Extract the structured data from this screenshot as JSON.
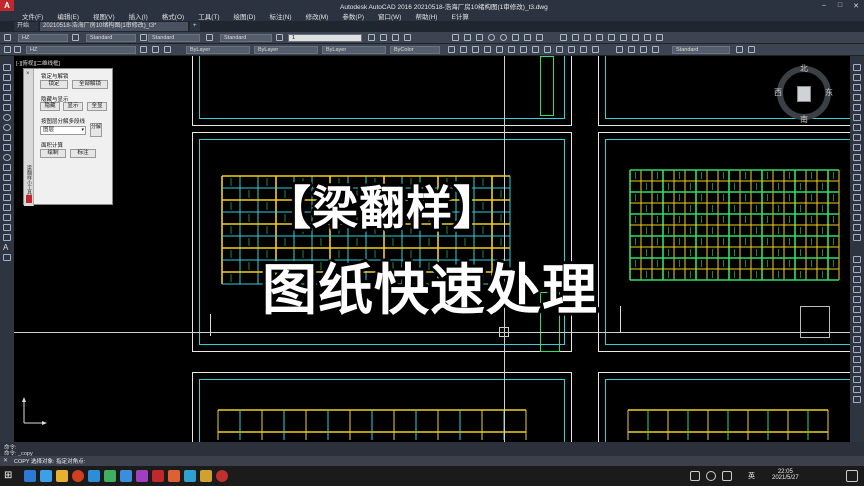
{
  "titlebar": {
    "title": "Autodesk AutoCAD 2016    20210518-浩海厂房10绪构图(1审修改)_t3.dwg",
    "logo_text": "A"
  },
  "menu": [
    "文件(F)",
    "编辑(E)",
    "视图(V)",
    "插入(I)",
    "格式(O)",
    "工具(T)",
    "绘图(D)",
    "标注(N)",
    "修改(M)",
    "参数(P)",
    "窗口(W)",
    "帮助(H)",
    "E计算"
  ],
  "tabs": {
    "start_tab": "开始",
    "doc_tab": "20210518-浩海厂房10绪构图(1审修改)_t3*",
    "add_tab": "+"
  },
  "toolbar": {
    "layer_combo": "HZ",
    "text_style": "Standard",
    "dim_style": "Standard",
    "table_style": "Standard",
    "mleader_style": "Standard",
    "layer_name": "1",
    "color_combo": "ByLayer",
    "linetype_combo": "ByLayer",
    "lineweight_combo": "ByLayer",
    "plotstyle_combo": "ByColor",
    "standard_right": "Standard"
  },
  "viewport_label": "[-][俯视][二维线框]",
  "overlay": {
    "line1": "【梁翻样】",
    "line2": "图纸快速处理"
  },
  "panel": {
    "section1": "锁定与解锁",
    "lock": "锁定",
    "unlock_all": "全部解锁",
    "section2": "隐藏与显示",
    "hide": "隐藏",
    "show": "显示",
    "show_all": "全显",
    "section3": "按图层分解多段线",
    "layer_select": "图层",
    "explode": "分解",
    "section4": "面积计算",
    "draw": "绘制",
    "annotate": "标注",
    "close": "×",
    "side_label": "梁翻样小工具"
  },
  "compass": {
    "north": "北",
    "south": "南",
    "east": "东",
    "west": "西"
  },
  "command": {
    "hist1": "命令:",
    "hist2": "命令: _copy",
    "prompt": "COPY 选择对象: 指定对角点:"
  },
  "taskbar": {
    "ime": "英",
    "time": "22:05",
    "date": "2021/5/27"
  },
  "colors": {
    "frame_cyan": "#2fd0d8",
    "beam_yellow": "#f0d020",
    "grid_green": "#33dd66",
    "accent_red": "#c0282d"
  }
}
